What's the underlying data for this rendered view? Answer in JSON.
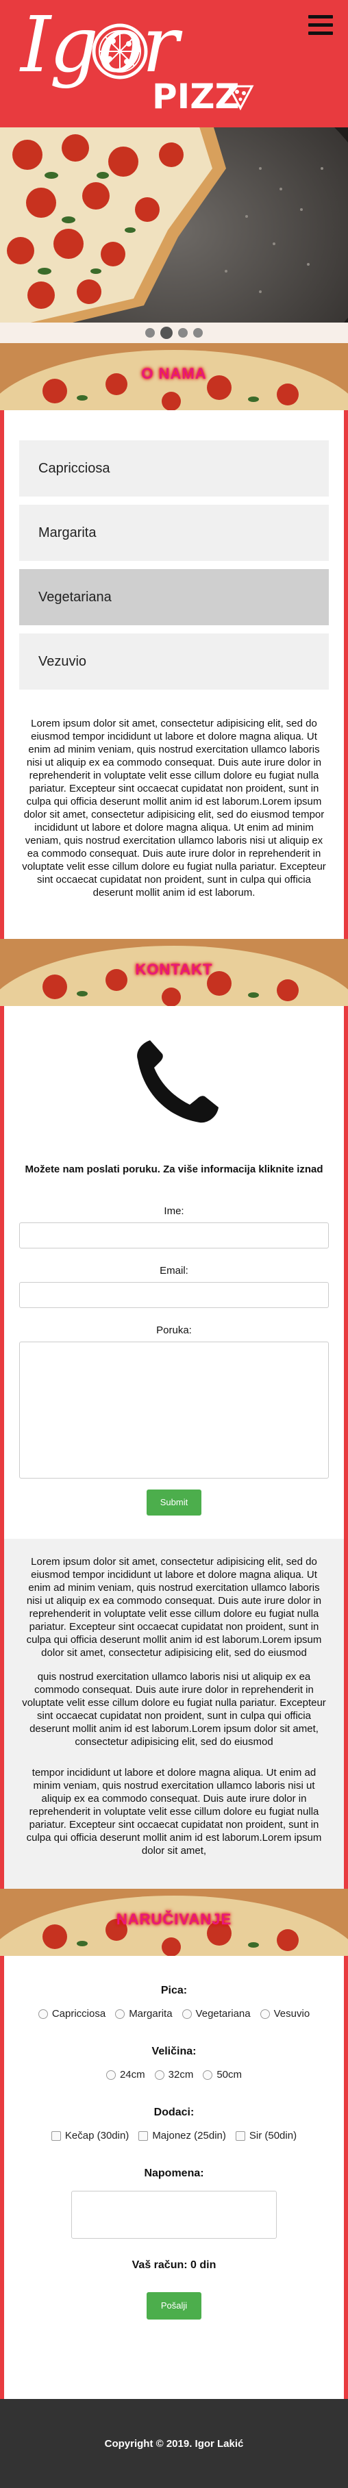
{
  "header": {
    "logo_left": "Igor",
    "logo_right": "PIZZ"
  },
  "carousel": {
    "slide_count": 4,
    "active_index": 1
  },
  "sections": {
    "menu_title": "O NAMA",
    "contact_title": "KONTAKT",
    "order_title": "NARUČIVANJE"
  },
  "menu": {
    "items": [
      "Capricciosa",
      "Margarita",
      "Vegetariana",
      "Vezuvio"
    ],
    "selected_index": 2
  },
  "about_text": "Lorem ipsum dolor sit amet, consectetur adipisicing elit, sed do eiusmod tempor incididunt ut labore et dolore magna aliqua. Ut enim ad minim veniam, quis nostrud exercitation ullamco laboris nisi ut aliquip ex ea commodo consequat. Duis aute irure dolor in reprehenderit in voluptate velit esse cillum dolore eu fugiat nulla pariatur. Excepteur sint occaecat cupidatat non proident, sunt in culpa qui officia deserunt mollit anim id est laborum.Lorem ipsum dolor sit amet, consectetur adipisicing elit, sed do eiusmod tempor incididunt ut labore et dolore magna aliqua. Ut enim ad minim veniam, quis nostrud exercitation ullamco laboris nisi ut aliquip ex ea commodo consequat. Duis aute irure dolor in reprehenderit in voluptate velit esse cillum dolore eu fugiat nulla pariatur. Excepteur sint occaecat cupidatat non proident, sunt in culpa qui officia deserunt mollit anim id est laborum.",
  "contact": {
    "lead": "Možete nam poslati poruku. Za više informacija kliknite iznad",
    "name_label": "Ime:",
    "email_label": "Email:",
    "message_label": "Poruka:",
    "submit_label": "Submit"
  },
  "info_paragraphs": [
    "Lorem ipsum dolor sit amet, consectetur adipisicing elit, sed do eiusmod tempor incididunt ut labore et dolore magna aliqua. Ut enim ad minim veniam, quis nostrud exercitation ullamco laboris nisi ut aliquip ex ea commodo consequat. Duis aute irure dolor in reprehenderit in voluptate velit esse cillum dolore eu fugiat nulla pariatur. Excepteur sint occaecat cupidatat non proident, sunt in culpa qui officia deserunt mollit anim id est laborum.Lorem ipsum dolor sit amet, consectetur adipisicing elit, sed do eiusmod",
    "quis nostrud exercitation ullamco laboris nisi ut aliquip ex ea commodo consequat. Duis aute irure dolor in reprehenderit in voluptate velit esse cillum dolore eu fugiat nulla pariatur. Excepteur sint occaecat cupidatat non proident, sunt in culpa qui officia deserunt mollit anim id est laborum.Lorem ipsum dolor sit amet, consectetur adipisicing elit, sed do eiusmod",
    "tempor incididunt ut labore et dolore magna aliqua. Ut enim ad minim veniam, quis nostrud exercitation ullamco laboris nisi ut aliquip ex ea commodo consequat. Duis aute irure dolor in reprehenderit in voluptate velit esse cillum dolore eu fugiat nulla pariatur. Excepteur sint occaecat cupidatat non proident, sunt in culpa qui officia deserunt mollit anim id est laborum.Lorem ipsum dolor sit amet,"
  ],
  "order": {
    "pizza_label": "Pica:",
    "pizza_options": [
      "Capricciosa",
      "Margarita",
      "Vegetariana",
      "Vesuvio"
    ],
    "size_label": "Veličina:",
    "size_options": [
      "24cm",
      "32cm",
      "50cm"
    ],
    "extras_label": "Dodaci:",
    "extras_options": [
      "Kečap (30din)",
      "Majonez (25din)",
      "Sir (50din)"
    ],
    "note_label": "Napomena:",
    "total_label": "Vaš račun: 0 din",
    "send_label": "Pošalji"
  },
  "footer": {
    "copyright": "Copyright © 2019. Igor Lakić"
  },
  "colors": {
    "brand_red": "#e83b3f",
    "button_green": "#4cae4c",
    "footer_bg": "#333333"
  }
}
